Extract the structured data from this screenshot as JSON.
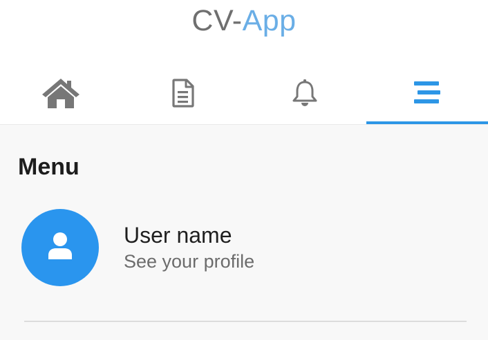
{
  "header": {
    "title_part1": "CV-",
    "title_part2": "App",
    "colors": {
      "title_gray": "#6f6f6f",
      "title_accent": "#6aaee6",
      "tab_active": "#2d96e6",
      "tab_inactive": "#777777"
    }
  },
  "tabs": [
    {
      "icon": "home-icon",
      "active": false
    },
    {
      "icon": "document-icon",
      "active": false
    },
    {
      "icon": "bell-icon",
      "active": false
    },
    {
      "icon": "menu-icon",
      "active": true
    }
  ],
  "menu": {
    "title": "Menu",
    "profile": {
      "avatar_icon": "user-icon",
      "avatar_color": "#2a95ee",
      "name": "User name",
      "subtitle": "See your profile"
    }
  }
}
